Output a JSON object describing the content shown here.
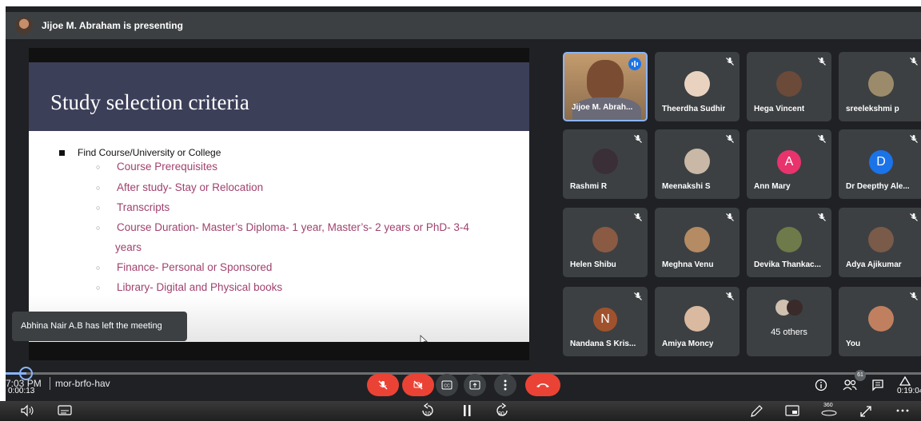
{
  "presenting_banner": "Jijoe M. Abraham is presenting",
  "slide": {
    "title": "Study selection criteria",
    "main_bullet": "Find Course/University or College",
    "sub_bullets": [
      "Course Prerequisites",
      "After study- Stay or Relocation",
      "Transcripts",
      "Course Duration- Master’s Diploma- 1 year, Master’s- 2 years or PhD- 3-4",
      "years",
      "Finance- Personal or Sponsored",
      "Library- Digital and Physical books"
    ]
  },
  "toast": "Abhina Nair A.B has left the meeting",
  "participants": [
    {
      "name": "Jijoe M. Abrah...",
      "type": "video"
    },
    {
      "name": "Theerdha Sudhir",
      "type": "photo"
    },
    {
      "name": "Hega Vincent",
      "type": "photo"
    },
    {
      "name": "sreelekshmi p",
      "type": "photo"
    },
    {
      "name": "Rashmi R",
      "type": "photo"
    },
    {
      "name": "Meenakshi S",
      "type": "photo"
    },
    {
      "name": "Ann Mary",
      "type": "letter",
      "letter": "A",
      "color": "#e8336d"
    },
    {
      "name": "Dr Deepthy Ale...",
      "type": "letter",
      "letter": "D",
      "color": "#1a73e8"
    },
    {
      "name": "Helen Shibu",
      "type": "photo"
    },
    {
      "name": "Meghna Venu",
      "type": "photo"
    },
    {
      "name": "Devika Thankac...",
      "type": "photo"
    },
    {
      "name": "Adya Ajikumar",
      "type": "photo"
    },
    {
      "name": "Nandana S Kris...",
      "type": "letter",
      "letter": "N",
      "color": "#a0522d"
    },
    {
      "name": "Amiya Moncy",
      "type": "photo"
    },
    {
      "name": "45 others",
      "type": "others"
    },
    {
      "name": "You",
      "type": "photo"
    }
  ],
  "bottom": {
    "time": "7:03 PM",
    "meeting_code": "mor-brfo-hav",
    "people_count": "61"
  },
  "player": {
    "elapsed": "0:00:13",
    "duration": "0:19:04",
    "progress_fraction": 0.011,
    "rewind_label": "10",
    "forward_label": "30",
    "vr_label": "360"
  },
  "colors": {
    "meet_bg": "#202124",
    "tile_bg": "#3c4043",
    "end_call": "#ea4335",
    "slide_header": "#3c3f58",
    "sub_bullet_text": "#a0426e"
  }
}
